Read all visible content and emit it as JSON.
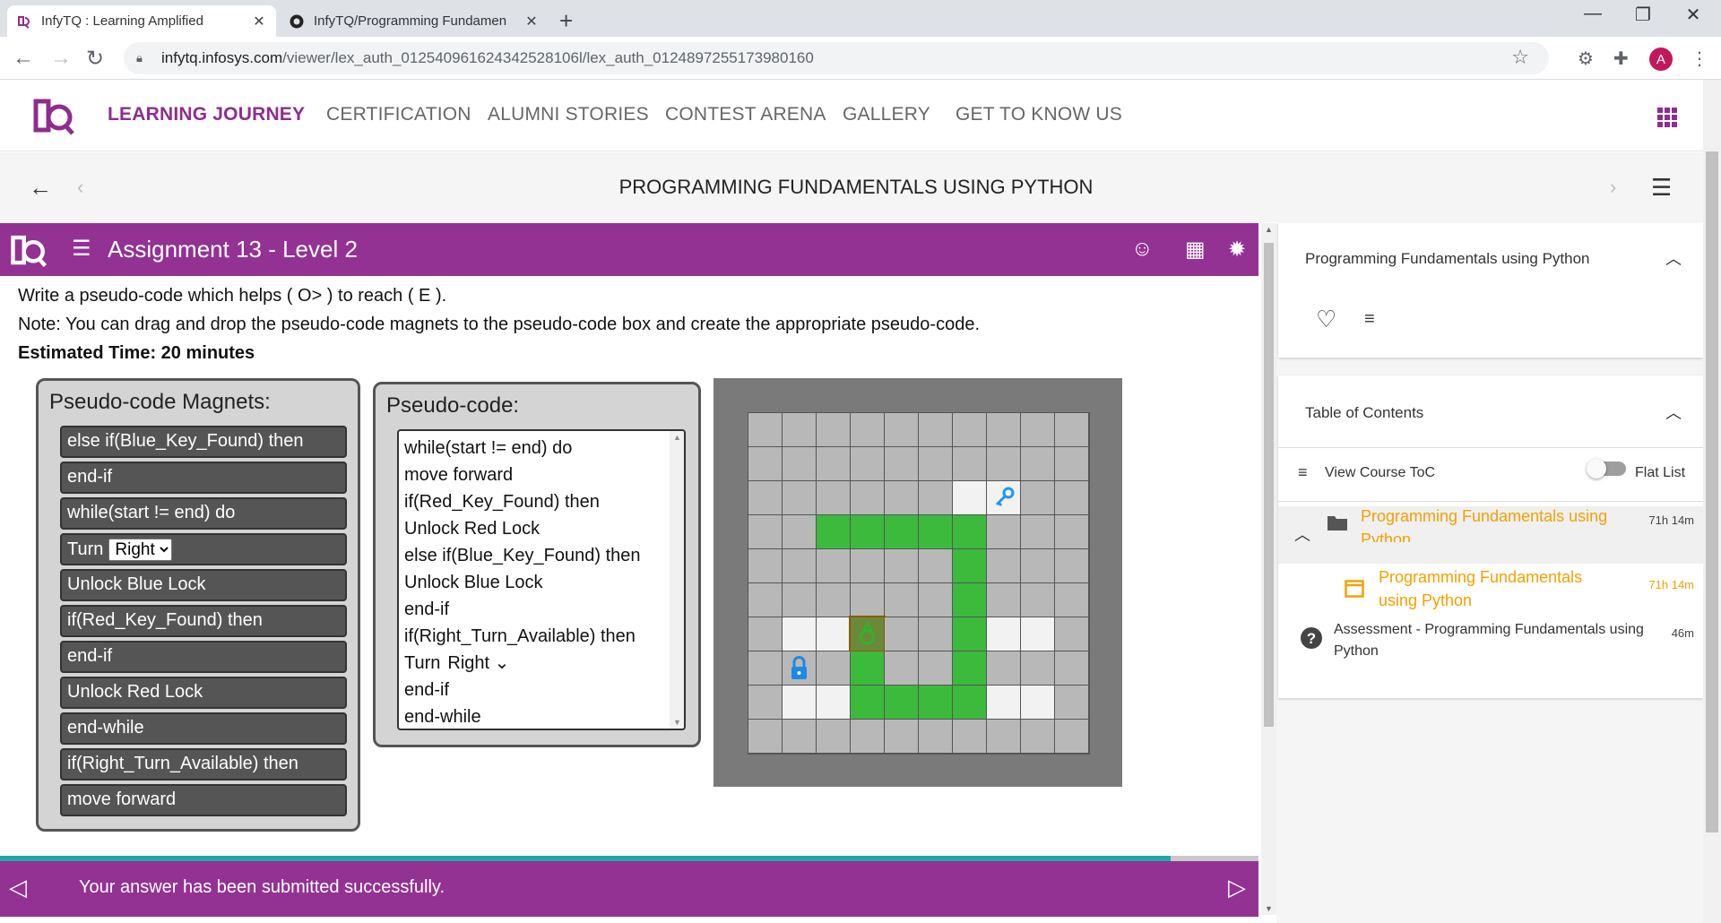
{
  "browser": {
    "tabs": [
      {
        "label": "InfyTQ : Learning Amplified",
        "active": true
      },
      {
        "label": "InfyTQ/Programming Fundamen",
        "active": false
      }
    ],
    "url_host": "infytq.infosys.com",
    "url_path": "/viewer/lex_auth_012540961624342528106l/lex_auth_0124897255173980160",
    "profile_initial": "A"
  },
  "site_nav": {
    "items": [
      "LEARNING JOURNEY",
      "CERTIFICATION",
      "ALUMNI STORIES",
      "CONTEST ARENA",
      "GALLERY",
      "GET TO KNOW US"
    ],
    "active": "LEARNING JOURNEY"
  },
  "course": {
    "title": "PROGRAMMING FUNDAMENTALS USING PYTHON"
  },
  "assignment": {
    "title": "Assignment 13 - Level 2",
    "instruction": "Write a pseudo-code which helps ( O> ) to reach ( E ).",
    "note": "Note: You can drag and drop the pseudo-code magnets to the pseudo-code box and create the appropriate pseudo-code.",
    "estimated_time": "Estimated Time: 20 minutes"
  },
  "magnets": {
    "title": "Pseudo-code Magnets:",
    "items": [
      "else if(Blue_Key_Found) then",
      "end-if",
      "while(start != end) do",
      "Turn",
      "Unlock Blue Lock",
      "if(Red_Key_Found) then",
      "end-if",
      "Unlock Red Lock",
      "end-while",
      "if(Right_Turn_Available) then",
      "move forward"
    ],
    "turn_select": "Right"
  },
  "pseudocode": {
    "title": "Pseudo-code:",
    "lines": [
      "while(start != end) do",
      "move forward",
      "if(Red_Key_Found) then",
      "Unlock Red Lock",
      "else if(Blue_Key_Found) then",
      "Unlock Blue Lock",
      "end-if",
      "if(Right_Turn_Available) then",
      "Turn",
      "end-if",
      "end-while"
    ],
    "turn_select": "Right"
  },
  "maze": {
    "rows": 10,
    "cols": 10,
    "path_cells": [
      [
        3,
        2
      ],
      [
        3,
        3
      ],
      [
        3,
        4
      ],
      [
        3,
        5
      ],
      [
        3,
        6
      ],
      [
        4,
        6
      ],
      [
        5,
        6
      ],
      [
        6,
        6
      ],
      [
        7,
        6
      ],
      [
        8,
        6
      ],
      [
        6,
        3
      ],
      [
        7,
        3
      ],
      [
        8,
        3
      ],
      [
        8,
        4
      ],
      [
        8,
        5
      ]
    ],
    "white_cells": [
      [
        2,
        6
      ],
      [
        2,
        7
      ],
      [
        6,
        1
      ],
      [
        6,
        2
      ],
      [
        6,
        7
      ],
      [
        6,
        8
      ],
      [
        8,
        1
      ],
      [
        8,
        2
      ],
      [
        8,
        7
      ],
      [
        8,
        8
      ]
    ],
    "key_cell": [
      2,
      7
    ],
    "lock_cell": [
      7,
      1
    ],
    "start_cell": [
      6,
      3
    ],
    "colors": {
      "path": "#3cba3c",
      "floor": "#b8b8b8",
      "white": "#f2f2f2",
      "key": "#2196f3",
      "lock": "#1e88e5"
    }
  },
  "status": {
    "message": "Your answer has been submitted successfully.",
    "progress_fraction": 0.93
  },
  "sidebar": {
    "course_card_title": "Programming Fundamentals using Python",
    "toc_title": "Table of Contents",
    "view_toc": "View Course ToC",
    "flat_list": "Flat List",
    "entries": [
      {
        "label": "Programming Fundamentals using Python",
        "duration": "71h 14m"
      },
      {
        "label": "Programming Fundamentals using Python",
        "duration": "71h 14m"
      },
      {
        "label": "Assessment - Programming Fundamentals using Python",
        "duration": "46m"
      }
    ]
  },
  "colors": {
    "brand": "#933293",
    "accent_orange": "#f5a000",
    "teal": "#1fa8a8"
  }
}
